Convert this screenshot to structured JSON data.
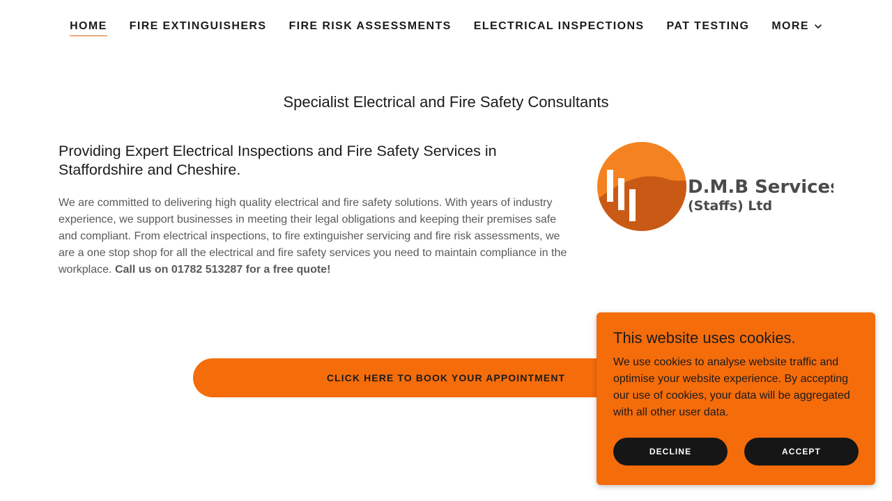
{
  "nav": {
    "items": [
      {
        "label": "HOME"
      },
      {
        "label": "FIRE EXTINGUISHERS"
      },
      {
        "label": "FIRE RISK ASSESSMENTS"
      },
      {
        "label": "ELECTRICAL INSPECTIONS"
      },
      {
        "label": "PAT TESTING"
      },
      {
        "label": "MORE"
      }
    ],
    "more_icon": "chevron-down-icon"
  },
  "tagline": "Specialist Electrical and Fire Safety Consultants",
  "intro": {
    "heading": "Providing Expert Electrical Inspections and Fire Safety Services in Staffordshire and Cheshire.",
    "body": "We are committed to delivering high quality electrical and fire safety solutions. With years of industry experience, we support businesses in meeting their legal obligations and keeping their premises safe and compliant. From electrical inspections, to fire extinguisher servicing and fire risk assessments, we are a one stop shop for all the electrical and fire safety services you need to maintain compliance in the workplace.",
    "cta_bold": "Call us on 01782 513287 for a free quote!"
  },
  "logo": {
    "line1": "D.M.B Services",
    "line2": "(Staffs) Ltd"
  },
  "book_button": "CLICK HERE TO BOOK YOUR APPOINTMENT",
  "cookie": {
    "title": "This website uses cookies.",
    "text": "We use cookies to analyse website traffic and optimise your website experience. By accepting our use of cookies, your data will be aggregated with all other user data.",
    "decline": "DECLINE",
    "accept": "ACCEPT"
  },
  "colors": {
    "accent": "#f56c0b",
    "text": "#1b1b1b",
    "body_text": "#595959",
    "button_dark": "#161616"
  }
}
